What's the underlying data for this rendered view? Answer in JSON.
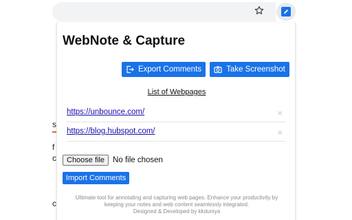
{
  "popup": {
    "title": "WebNote & Capture",
    "export_label": "Export Comments",
    "screenshot_label": "Take Screenshot",
    "list_heading": "List of Webpages",
    "webpages": [
      {
        "url": "https://unbounce.com/",
        "remove": "×"
      },
      {
        "url": "https://blog.hubspot.com/",
        "remove": "×"
      }
    ],
    "file_button_label": "Choose file",
    "file_status": "No file chosen",
    "import_label": "Import Comments",
    "footer_line1": "Ultimate tool for annotating and capturing web pages. Enhance your productivity by",
    "footer_line2": "keeping your notes and web content seamlessly integrated.",
    "footer_line3": "Designed & Developed by kkduniya"
  },
  "background_page": {
    "chars": [
      "s",
      "f",
      "c",
      "c"
    ]
  },
  "colors": {
    "accent": "#1a73e8",
    "link": "#1a0dab"
  },
  "icons": {
    "bookmark": "star-icon",
    "extension": "pencil-icon",
    "export": "export-icon",
    "screenshot": "camera-icon",
    "remove": "close-icon"
  }
}
